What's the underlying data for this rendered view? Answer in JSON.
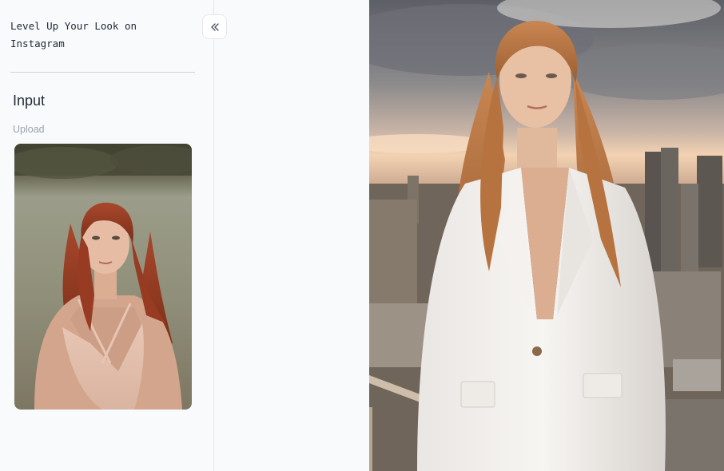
{
  "sidebar": {
    "title": "Level Up Your Look on Instagram",
    "collapse_icon": "chevrons-left-icon",
    "input": {
      "heading": "Input",
      "upload_label": "Upload"
    }
  },
  "colors": {
    "background": "#f8fafc",
    "divider": "#d1d5db",
    "title_text": "#1f2937",
    "label_text": "#9ca3af"
  }
}
